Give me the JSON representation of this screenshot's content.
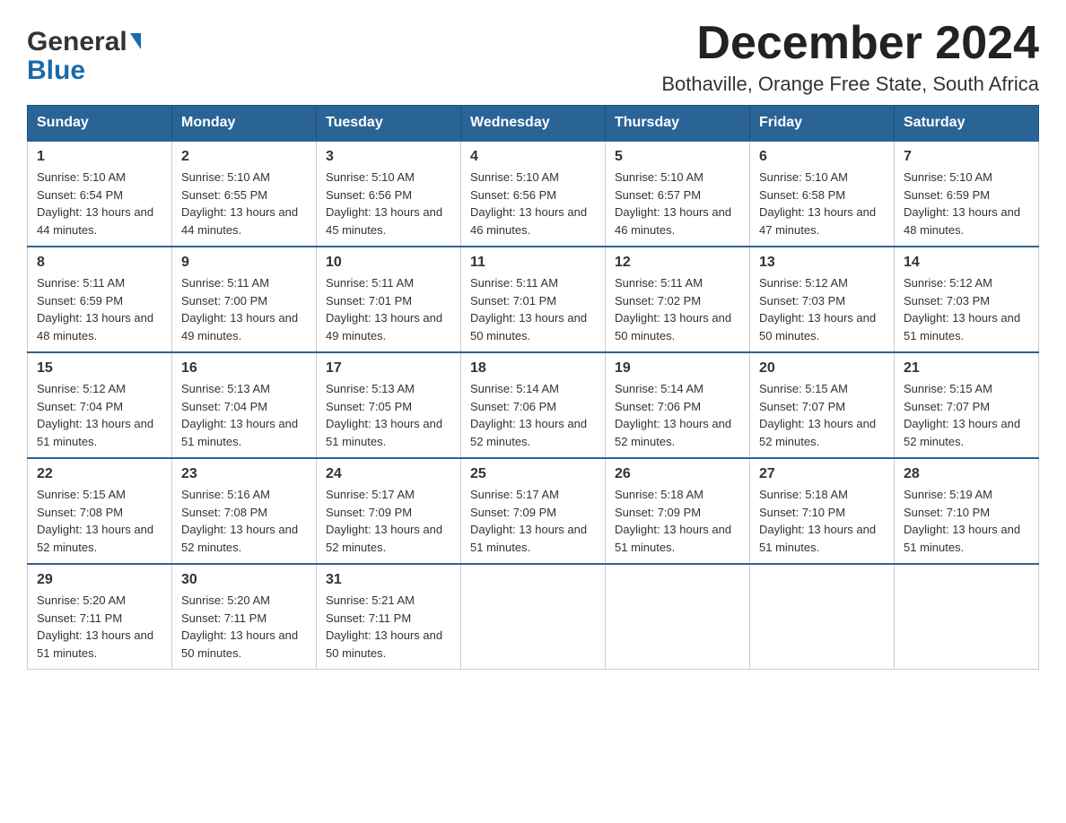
{
  "header": {
    "logo_general": "General",
    "logo_blue": "Blue",
    "month_title": "December 2024",
    "location": "Bothaville, Orange Free State, South Africa"
  },
  "weekdays": [
    "Sunday",
    "Monday",
    "Tuesday",
    "Wednesday",
    "Thursday",
    "Friday",
    "Saturday"
  ],
  "weeks": [
    [
      {
        "day": "1",
        "sunrise": "5:10 AM",
        "sunset": "6:54 PM",
        "daylight": "13 hours and 44 minutes."
      },
      {
        "day": "2",
        "sunrise": "5:10 AM",
        "sunset": "6:55 PM",
        "daylight": "13 hours and 44 minutes."
      },
      {
        "day": "3",
        "sunrise": "5:10 AM",
        "sunset": "6:56 PM",
        "daylight": "13 hours and 45 minutes."
      },
      {
        "day": "4",
        "sunrise": "5:10 AM",
        "sunset": "6:56 PM",
        "daylight": "13 hours and 46 minutes."
      },
      {
        "day": "5",
        "sunrise": "5:10 AM",
        "sunset": "6:57 PM",
        "daylight": "13 hours and 46 minutes."
      },
      {
        "day": "6",
        "sunrise": "5:10 AM",
        "sunset": "6:58 PM",
        "daylight": "13 hours and 47 minutes."
      },
      {
        "day": "7",
        "sunrise": "5:10 AM",
        "sunset": "6:59 PM",
        "daylight": "13 hours and 48 minutes."
      }
    ],
    [
      {
        "day": "8",
        "sunrise": "5:11 AM",
        "sunset": "6:59 PM",
        "daylight": "13 hours and 48 minutes."
      },
      {
        "day": "9",
        "sunrise": "5:11 AM",
        "sunset": "7:00 PM",
        "daylight": "13 hours and 49 minutes."
      },
      {
        "day": "10",
        "sunrise": "5:11 AM",
        "sunset": "7:01 PM",
        "daylight": "13 hours and 49 minutes."
      },
      {
        "day": "11",
        "sunrise": "5:11 AM",
        "sunset": "7:01 PM",
        "daylight": "13 hours and 50 minutes."
      },
      {
        "day": "12",
        "sunrise": "5:11 AM",
        "sunset": "7:02 PM",
        "daylight": "13 hours and 50 minutes."
      },
      {
        "day": "13",
        "sunrise": "5:12 AM",
        "sunset": "7:03 PM",
        "daylight": "13 hours and 50 minutes."
      },
      {
        "day": "14",
        "sunrise": "5:12 AM",
        "sunset": "7:03 PM",
        "daylight": "13 hours and 51 minutes."
      }
    ],
    [
      {
        "day": "15",
        "sunrise": "5:12 AM",
        "sunset": "7:04 PM",
        "daylight": "13 hours and 51 minutes."
      },
      {
        "day": "16",
        "sunrise": "5:13 AM",
        "sunset": "7:04 PM",
        "daylight": "13 hours and 51 minutes."
      },
      {
        "day": "17",
        "sunrise": "5:13 AM",
        "sunset": "7:05 PM",
        "daylight": "13 hours and 51 minutes."
      },
      {
        "day": "18",
        "sunrise": "5:14 AM",
        "sunset": "7:06 PM",
        "daylight": "13 hours and 52 minutes."
      },
      {
        "day": "19",
        "sunrise": "5:14 AM",
        "sunset": "7:06 PM",
        "daylight": "13 hours and 52 minutes."
      },
      {
        "day": "20",
        "sunrise": "5:15 AM",
        "sunset": "7:07 PM",
        "daylight": "13 hours and 52 minutes."
      },
      {
        "day": "21",
        "sunrise": "5:15 AM",
        "sunset": "7:07 PM",
        "daylight": "13 hours and 52 minutes."
      }
    ],
    [
      {
        "day": "22",
        "sunrise": "5:15 AM",
        "sunset": "7:08 PM",
        "daylight": "13 hours and 52 minutes."
      },
      {
        "day": "23",
        "sunrise": "5:16 AM",
        "sunset": "7:08 PM",
        "daylight": "13 hours and 52 minutes."
      },
      {
        "day": "24",
        "sunrise": "5:17 AM",
        "sunset": "7:09 PM",
        "daylight": "13 hours and 52 minutes."
      },
      {
        "day": "25",
        "sunrise": "5:17 AM",
        "sunset": "7:09 PM",
        "daylight": "13 hours and 51 minutes."
      },
      {
        "day": "26",
        "sunrise": "5:18 AM",
        "sunset": "7:09 PM",
        "daylight": "13 hours and 51 minutes."
      },
      {
        "day": "27",
        "sunrise": "5:18 AM",
        "sunset": "7:10 PM",
        "daylight": "13 hours and 51 minutes."
      },
      {
        "day": "28",
        "sunrise": "5:19 AM",
        "sunset": "7:10 PM",
        "daylight": "13 hours and 51 minutes."
      }
    ],
    [
      {
        "day": "29",
        "sunrise": "5:20 AM",
        "sunset": "7:11 PM",
        "daylight": "13 hours and 51 minutes."
      },
      {
        "day": "30",
        "sunrise": "5:20 AM",
        "sunset": "7:11 PM",
        "daylight": "13 hours and 50 minutes."
      },
      {
        "day": "31",
        "sunrise": "5:21 AM",
        "sunset": "7:11 PM",
        "daylight": "13 hours and 50 minutes."
      },
      null,
      null,
      null,
      null
    ]
  ]
}
